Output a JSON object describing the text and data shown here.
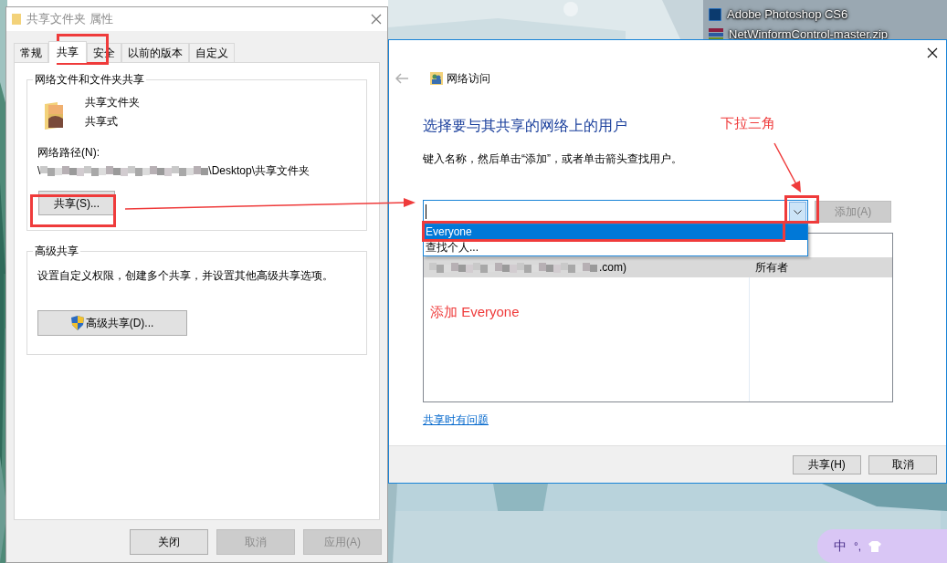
{
  "desktop": {
    "items": [
      {
        "label": "Adobe Photoshop CS6",
        "kind": "ps"
      },
      {
        "label": "NetWinformControl-master.zip",
        "kind": "zip"
      }
    ]
  },
  "properties_window": {
    "title": "共享文件夹 属性",
    "tabs": [
      {
        "label": "常规",
        "selected": false
      },
      {
        "label": "共享",
        "selected": true
      },
      {
        "label": "安全",
        "selected": false
      },
      {
        "label": "以前的版本",
        "selected": false
      },
      {
        "label": "自定义",
        "selected": false
      }
    ],
    "network_sharing": {
      "heading": "网络文件和文件夹共享",
      "folder_name": "共享文件夹",
      "status": "共享式",
      "path_label": "网络路径(N):",
      "path_start": "\\",
      "path_end": "\\Desktop\\共享文件夹",
      "share_button": "共享(S)..."
    },
    "advanced_sharing": {
      "heading": "高级共享",
      "description": "设置自定义权限，创建多个共享，并设置其他高级共享选项。",
      "button": "高级共享(D)..."
    },
    "buttons": [
      {
        "label": "关闭",
        "disabled": false
      },
      {
        "label": "取消",
        "disabled": true
      },
      {
        "label": "应用(A)",
        "disabled": true
      }
    ]
  },
  "network_access": {
    "title": "网络访问",
    "heading": "选择要与其共享的网络上的用户",
    "instruction": "键入名称，然后单击“添加”，或者单击箭头查找用户。",
    "add_button": {
      "label": "添加(A)",
      "disabled": true
    },
    "dropdown": [
      {
        "label": "Everyone",
        "selected": true
      },
      {
        "label": "查找个人...",
        "selected": false
      }
    ],
    "rows": [
      {
        "name_end": ".com)",
        "permission": "所有者",
        "selected": true
      }
    ],
    "help_link": "共享时有问题",
    "buttons": [
      {
        "label": "共享(H)",
        "disabled": false
      },
      {
        "label": "取消",
        "disabled": false
      }
    ]
  },
  "annotations": [
    {
      "text": "下拉三角"
    },
    {
      "text": "添加 Everyone"
    }
  ],
  "ime": {
    "mode": "中",
    "punctuation": "°,"
  }
}
